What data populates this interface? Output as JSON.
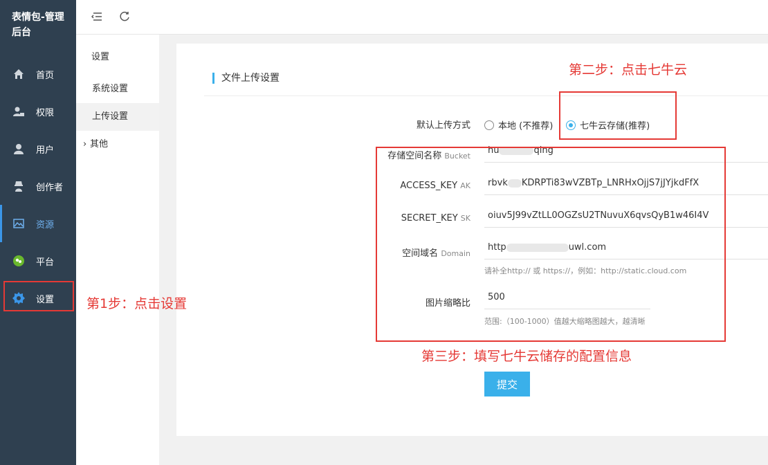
{
  "app": {
    "brand": "表情包-管理后台"
  },
  "sidebar": {
    "items": [
      {
        "label": "首页",
        "icon": "home-icon"
      },
      {
        "label": "权限",
        "icon": "user-lock-icon"
      },
      {
        "label": "用户",
        "icon": "user-icon"
      },
      {
        "label": "创作者",
        "icon": "spy-icon"
      },
      {
        "label": "资源",
        "icon": "image-icon"
      },
      {
        "label": "平台",
        "icon": "wechat-icon"
      },
      {
        "label": "设置",
        "icon": "gear-icon"
      }
    ]
  },
  "subnav": {
    "title": "设置",
    "items": [
      {
        "label": "系统设置"
      },
      {
        "label": "上传设置"
      },
      {
        "label": "其他"
      }
    ]
  },
  "form": {
    "section_title": "文件上传设置",
    "upload_method": {
      "label": "默认上传方式",
      "options": [
        "本地 (不推荐)",
        "七牛云存储(推荐)"
      ],
      "selected": "七牛云存储(推荐)"
    },
    "bucket": {
      "label": "存储空间名称",
      "sub": "Bucket",
      "value_start": "hu",
      "value_end": "qing"
    },
    "access_key": {
      "label": "ACCESS_KEY",
      "sub": "AK",
      "value_start": "rbvk",
      "value_end": "KDRPTi83wVZBTp_LNRHxOjjS7jJYjkdFfX"
    },
    "secret_key": {
      "label": "SECRET_KEY",
      "sub": "SK",
      "value_start": "oiuv5J99vZtLL0",
      "value_end": "OGZsU2TNuvuX6qvsQyB1w46I4V"
    },
    "domain": {
      "label": "空间域名",
      "sub": "Domain",
      "value_start": "http",
      "value_end": "uwl.com",
      "hint": "请补全http:// 或 https://，例如：http://static.cloud.com"
    },
    "thumb_ratio": {
      "label": "图片缩略比",
      "value": "500",
      "hint": "范围:（100-1000）值越大缩略图越大，越清晰"
    },
    "submit_label": "提交"
  },
  "annotations": {
    "step1": "第1步：点击设置",
    "step2": "第二步：点击七牛云",
    "step3": "第三步：填写七牛云储存的配置信息",
    "color": "#e53935"
  },
  "colors": {
    "sidebar_bg": "#2f4050",
    "accent": "#3ab0ea"
  }
}
